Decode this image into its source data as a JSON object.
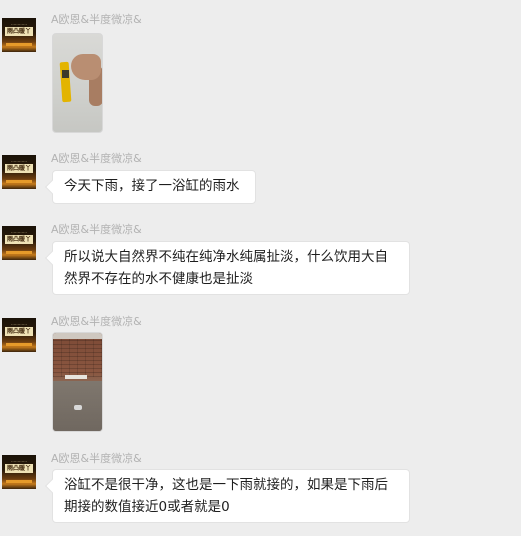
{
  "avatar": {
    "tiny_text": "…………",
    "plaque_text": "雨凸暖丫"
  },
  "messages": [
    {
      "sender": "A欧恩&半度微凉&",
      "type": "image",
      "image": "photo-hand-meter"
    },
    {
      "sender": "A欧恩&半度微凉&",
      "type": "text",
      "text": "今天下雨，接了一浴缸的雨水"
    },
    {
      "sender": "A欧恩&半度微凉&",
      "type": "text",
      "lines": [
        "所以说大自然界不纯在纯净水纯属扯淡，什么饮用大自",
        "然界不存在的水不健康也是扯淡"
      ]
    },
    {
      "sender": "A欧恩&半度微凉&",
      "type": "image",
      "image": "photo-brick-yard"
    },
    {
      "sender": "A欧恩&半度微凉&",
      "type": "text",
      "lines": [
        "浴缸不是很干净，这也是一下雨就接的，如果是下雨后",
        "期接的数值接近0或者就是0"
      ]
    }
  ]
}
